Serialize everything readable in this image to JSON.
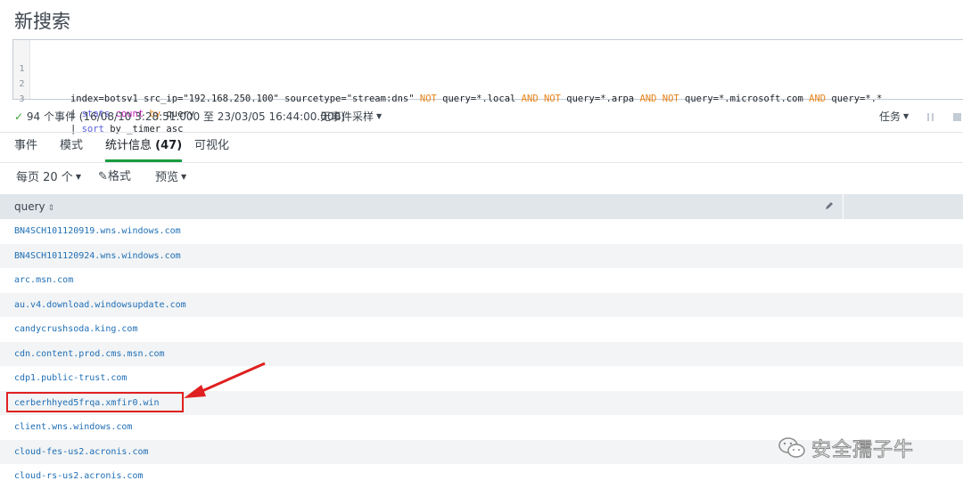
{
  "page_title": "新搜索",
  "search": {
    "lines": [
      {
        "num": "1"
      },
      {
        "num": "2"
      },
      {
        "num": "3"
      }
    ],
    "line1": {
      "a": "index=botsv1 src_ip=\"192.168.250.100\" sourcetype=\"stream:dns\" ",
      "not1": "NOT",
      "b": " query=*.local ",
      "and1": "AND",
      "sp1": " ",
      "not2": "NOT",
      "c": " query=*.arpa ",
      "and2": "AND",
      "sp2": " ",
      "not3": "NOT",
      "d": " query=*.microsoft.com ",
      "and3": "AND",
      "e": " query=*.*"
    },
    "line2": {
      "pipe": "| ",
      "cmd": "stats",
      "sp": " ",
      "fn": "count",
      "sp2": " ",
      "by": "by",
      "arg": " query"
    },
    "line3": {
      "pipe": "| ",
      "cmd": "sort",
      "arg": " by _timer asc"
    }
  },
  "status": {
    "check": "✓",
    "summary": "94 个事件 (16/08/10 3:28:51.000 至 23/03/05 16:44:00.000)",
    "sampling": "无事件采样",
    "jobs": "任务"
  },
  "tabs": [
    {
      "label": "事件"
    },
    {
      "label": "模式"
    },
    {
      "label": "统计信息",
      "count": "(47)"
    },
    {
      "label": "可视化"
    }
  ],
  "toolbar": {
    "per_page": "每页 20 个",
    "format": "格式",
    "preview": "预览"
  },
  "table": {
    "column": "query",
    "rows": [
      "BN4SCH101120919.wns.windows.com",
      "BN4SCH101120924.wns.windows.com",
      "arc.msn.com",
      "au.v4.download.windowsupdate.com",
      "candycrushsoda.king.com",
      "cdn.content.prod.cms.msn.com",
      "cdp1.public-trust.com",
      "cerberhhyed5frqa.xmfir0.win",
      "client.wns.windows.com",
      "cloud-fes-us2.acronis.com",
      "cloud-rs-us2.acronis.com"
    ]
  },
  "watermark": "安全孺子牛",
  "colors": {
    "accent_tab": "#1a9c3e",
    "link": "#1e6eb5",
    "keyword": "#e88218",
    "command": "#5a5fe0",
    "function": "#c71ebc",
    "annotation": "#e02020"
  }
}
